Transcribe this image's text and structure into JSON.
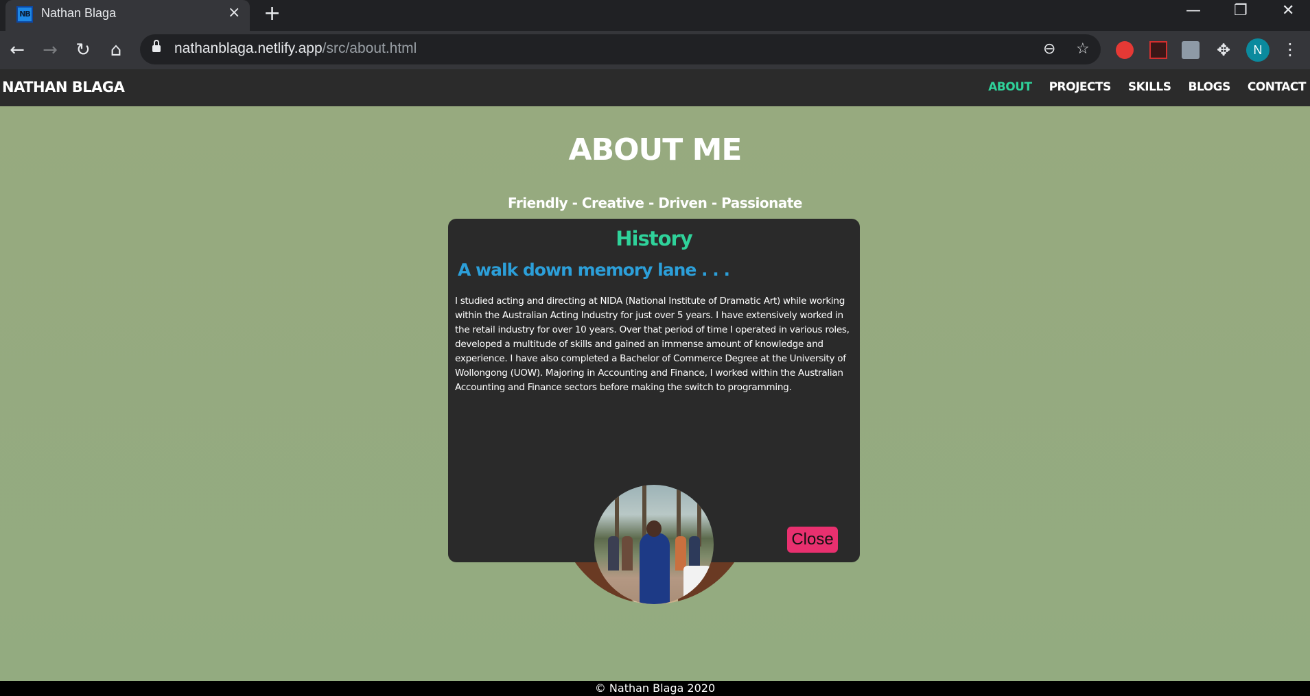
{
  "browser": {
    "tab": {
      "favicon_text": "NB",
      "title": "Nathan Blaga",
      "close_icon": "×"
    },
    "new_tab_icon": "+",
    "window_controls": {
      "minimize": "—",
      "restore": "❐",
      "close": "✕"
    },
    "nav": {
      "back": "←",
      "forward": "→",
      "reload": "↻",
      "home": "⌂"
    },
    "address": {
      "host": "nathanblaga.netlify.app",
      "path": "/src/about.html"
    },
    "omnibox_icons": {
      "zoom": "⊖",
      "bookmark": "☆"
    },
    "extensions": {
      "puzzle": "✥"
    },
    "profile_initial": "N",
    "menu_icon": "⋮"
  },
  "site": {
    "brand": "NATHAN BLAGA",
    "nav": [
      {
        "label": "ABOUT",
        "active": true
      },
      {
        "label": "PROJECTS",
        "active": false
      },
      {
        "label": "SKILLS",
        "active": false
      },
      {
        "label": "BLOGS",
        "active": false
      },
      {
        "label": "CONTACT",
        "active": false
      }
    ],
    "page_title": "ABOUT ME",
    "tagline": "Friendly - Creative - Driven - Passionate",
    "footer": "© Nathan Blaga 2020"
  },
  "modal": {
    "title": "History",
    "subtitle": "A walk down memory lane . . .",
    "body": "I studied acting and directing at NIDA (National Institute of Dramatic Art) while working within the Australian Acting Industry for just over 5 years. I have extensively worked in the retail industry for over 10 years. Over that period of time I operated in various roles, developed a multitude of skills and gained an immense amount of knowledge and experience. I have also completed a Bachelor of Commerce Degree at the University of Wollongong (UOW). Majoring in Accounting and Finance, I worked within the Australian Accounting and Finance sectors before making the switch to programming.",
    "close_label": "Close"
  },
  "colors": {
    "accent_green": "#2fd29a",
    "subtitle_blue": "#2c9fd9",
    "close_pink": "#e8306f",
    "page_bg": "#96aa7e"
  }
}
